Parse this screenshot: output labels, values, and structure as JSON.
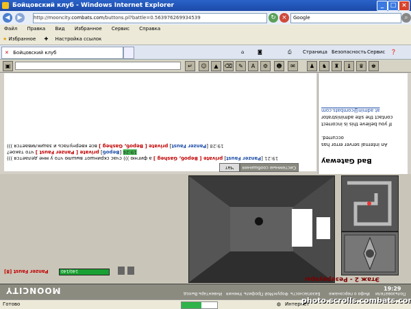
{
  "window": {
    "title": "Бойцовский клуб - Windows Internet Explorer",
    "min": "_",
    "max": "□",
    "close": "×"
  },
  "address": {
    "prefix": "http://mooncity.",
    "domain": "combats.com",
    "path": "/buttons.pl?battle=0.563976269934539",
    "search_placeholder": "Google"
  },
  "menu": [
    "Файл",
    "Правка",
    "Вид",
    "Избранное",
    "Сервис",
    "Справка"
  ],
  "favorites": {
    "label": "Избранное",
    "link": "Настройка ссылок"
  },
  "tab": {
    "title": "Бойцовский клуб"
  },
  "commands": {
    "page": "Страница",
    "security": "Безопасность",
    "tools": "Сервис"
  },
  "chat": {
    "messages": [
      {
        "time": "19:21",
        "nick": "Panzer Faust",
        "priv": "private [ Вероб, Gasheg ]",
        "text": "а фигню ))) счас скриншот вышлю что у мне делается )))"
      },
      {
        "time": "19:24",
        "nick": "Вероб",
        "priv": "private [ Panzer Faust ]",
        "text": "что такое?"
      },
      {
        "time": "19:28",
        "nick": "Panzer Faust",
        "priv": "private [ Вероб, Gasheg ]",
        "text": "все квернулась и зацикливается )))"
      }
    ],
    "tabs": [
      "Чат",
      "Системные сообщения"
    ]
  },
  "error": {
    "title": "Bad Gateway",
    "lines": [
      "An internal server error has",
      "occurred.",
      "If you believe this is incorrect",
      "contact the site administrator",
      "at admin@combats.com"
    ]
  },
  "game": {
    "location": "Этаж 2 - Резервуары",
    "player": "Panzer Faust [8]",
    "hp_text": "140/140",
    "hp_fraction": 1.0,
    "logo": "MOONCITY",
    "nav": [
      "Пользователи",
      "Инфо о персонаже",
      "Безопасность",
      "Форум",
      "Мой Профиль",
      "Умения",
      "Инвентарь",
      "Выход"
    ],
    "clock": "19:29"
  },
  "status": {
    "text": "Готово",
    "zone": "Интернет",
    "progress": 0.55
  },
  "watermark": "photo.scrolls.combats.com",
  "colors": {
    "titlebar": "#1c4aa8",
    "private": "#c00000",
    "nick": "#1f4fa8",
    "hp": "#19a032"
  }
}
